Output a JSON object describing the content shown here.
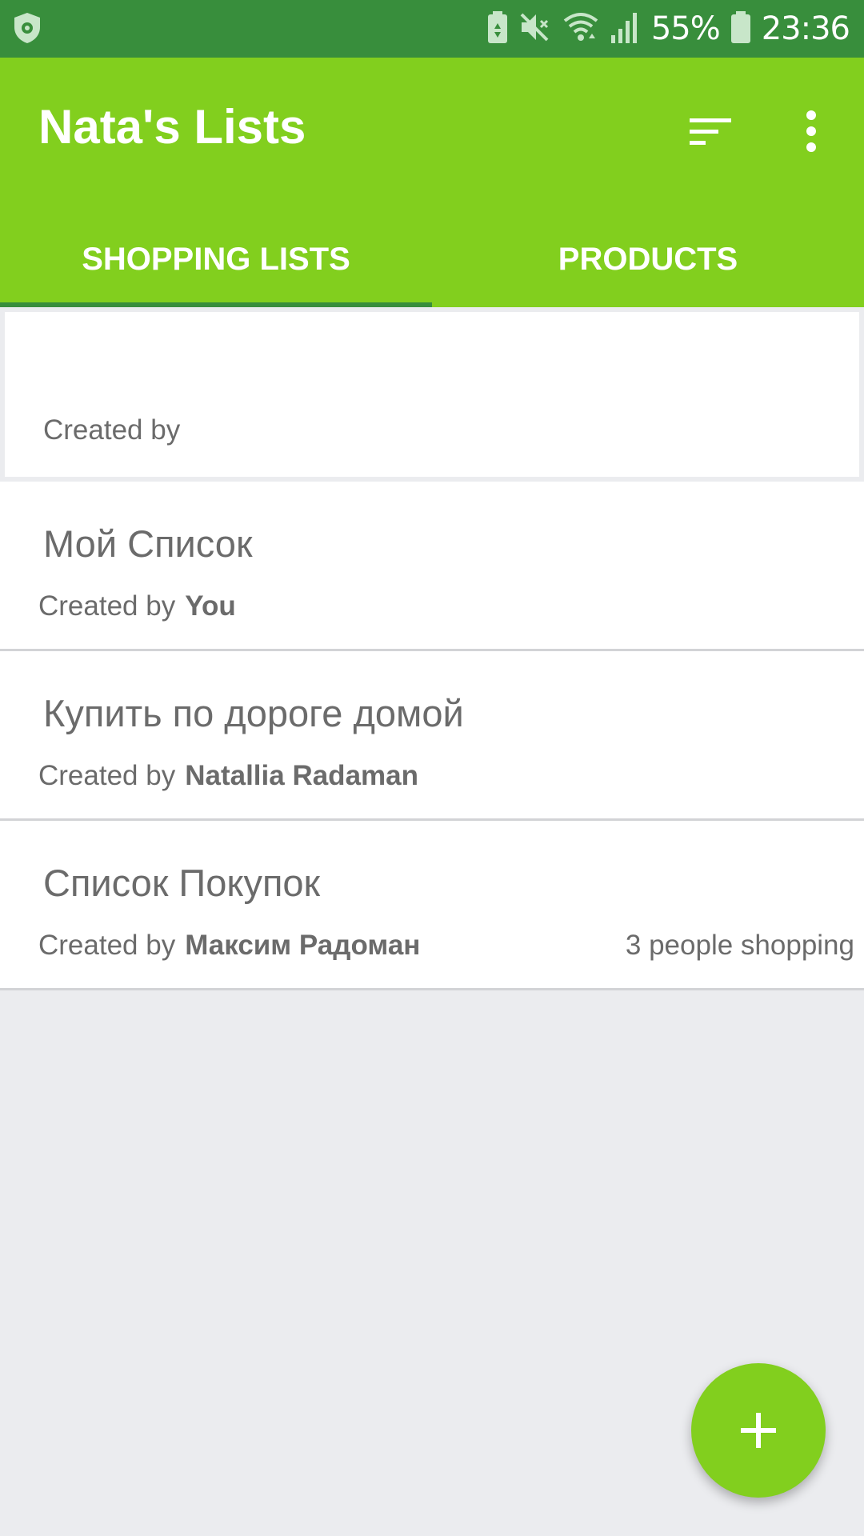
{
  "status_bar": {
    "battery_percent": "55%",
    "time": "23:36",
    "icons": [
      "antivirus-shield-icon",
      "battery-saver-icon",
      "mute-icon",
      "wifi-icon",
      "signal-icon",
      "battery-icon"
    ]
  },
  "app_bar": {
    "title": "Nata's Lists",
    "sort_icon": "sort-icon",
    "more_icon": "more-vert-icon"
  },
  "tabs": [
    {
      "label": "SHOPPING LISTS",
      "active": true
    },
    {
      "label": "PRODUCTS",
      "active": false
    }
  ],
  "lists": [
    {
      "name": "",
      "created_label": "Created by",
      "creator": "",
      "shopping_status": ""
    },
    {
      "name": "Мой Список",
      "created_label": "Created by",
      "creator": "You",
      "shopping_status": ""
    },
    {
      "name": "Купить по дороге домой",
      "created_label": "Created by",
      "creator": "Natallia Radaman",
      "shopping_status": ""
    },
    {
      "name": "Список Покупок",
      "created_label": "Created by",
      "creator": "Максим Радоман",
      "shopping_status": "3 people shopping"
    }
  ],
  "fab": {
    "icon": "add-icon"
  },
  "colors": {
    "status_bar": "#388e3c",
    "app_bar": "#82cf1e",
    "tab_indicator": "#388e3c",
    "background": "#ebecef",
    "text_secondary": "#6b6b6b"
  }
}
